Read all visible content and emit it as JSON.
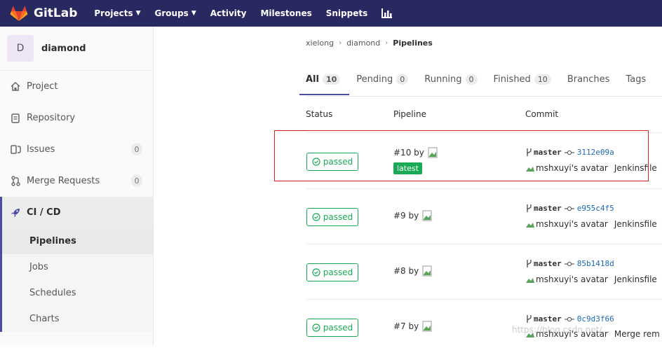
{
  "topnav": {
    "brand": "GitLab",
    "items": [
      {
        "label": "Projects",
        "dropdown": true
      },
      {
        "label": "Groups",
        "dropdown": true
      },
      {
        "label": "Activity"
      },
      {
        "label": "Milestones"
      },
      {
        "label": "Snippets"
      }
    ],
    "colors": {
      "bar": "#292961",
      "accent": "#4b4ba3"
    }
  },
  "sidebar": {
    "avatar_letter": "D",
    "project_name": "diamond",
    "items": [
      {
        "label": "Project",
        "icon": "home-icon"
      },
      {
        "label": "Repository",
        "icon": "document-icon"
      },
      {
        "label": "Issues",
        "icon": "issues-icon",
        "count": "0"
      },
      {
        "label": "Merge Requests",
        "icon": "merge-request-icon",
        "count": "0"
      },
      {
        "label": "CI / CD",
        "icon": "rocket-icon",
        "active": true
      }
    ],
    "subitems": [
      {
        "label": "Pipelines",
        "active": true
      },
      {
        "label": "Jobs"
      },
      {
        "label": "Schedules"
      },
      {
        "label": "Charts"
      }
    ]
  },
  "breadcrumb": [
    "xielong",
    "diamond",
    "Pipelines"
  ],
  "tabs": [
    {
      "label": "All",
      "count": "10",
      "active": true
    },
    {
      "label": "Pending",
      "count": "0"
    },
    {
      "label": "Running",
      "count": "0"
    },
    {
      "label": "Finished",
      "count": "10"
    },
    {
      "label": "Branches"
    },
    {
      "label": "Tags"
    }
  ],
  "table": {
    "headers": [
      "Status",
      "Pipeline",
      "Commit"
    ],
    "rows": [
      {
        "status": "passed",
        "pipeline": "#10 by",
        "latest": "latest",
        "branch": "master",
        "sha": "3112e09a",
        "author_alt": "mshxuyi's avatar",
        "message": "Jenkinsfile"
      },
      {
        "status": "passed",
        "pipeline": "#9 by",
        "branch": "master",
        "sha": "e955c4f5",
        "author_alt": "mshxuyi's avatar",
        "message": "Jenkinsfile"
      },
      {
        "status": "passed",
        "pipeline": "#8 by",
        "branch": "master",
        "sha": "85b1418d",
        "author_alt": "mshxuyi's avatar",
        "message": "Jenkinsfile"
      },
      {
        "status": "passed",
        "pipeline": "#7 by",
        "branch": "master",
        "sha": "0c9d3f66",
        "author_alt": "mshxuyi's avatar",
        "message": "Merge rem"
      }
    ]
  },
  "status_color": "#1aaa55",
  "watermark": "https://blog.csdn.net/..."
}
